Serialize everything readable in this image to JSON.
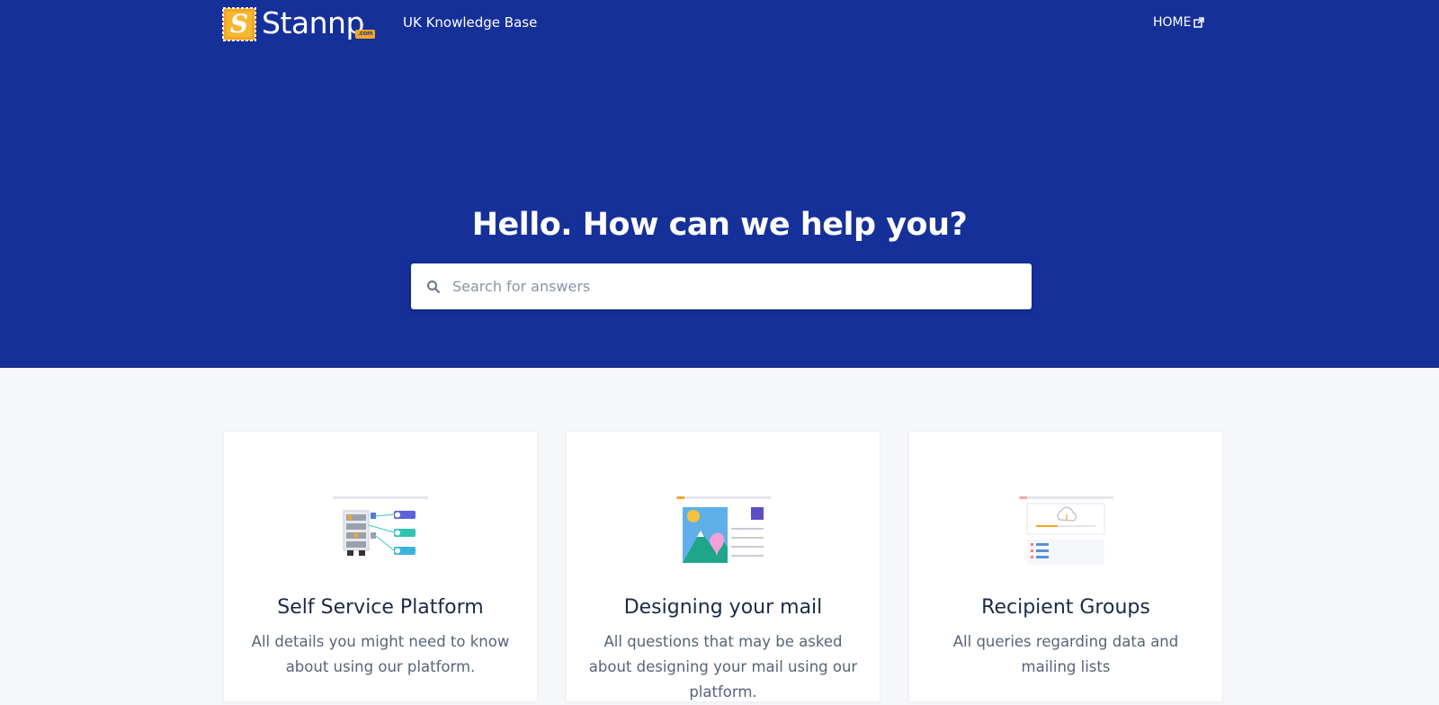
{
  "nav": {
    "logo_text": "Stannp",
    "logo_dotcom": ".com",
    "logo_letter": "S",
    "subtitle": "UK Knowledge Base",
    "home_label": "HOME",
    "home_icon": "external-link-icon"
  },
  "hero": {
    "title": "Hello. How can we help you?",
    "search_placeholder": "Search for answers",
    "search_value": "",
    "search_icon": "search-icon"
  },
  "categories": [
    {
      "title": "Self Service Platform",
      "description": "All details you might need to know about using our platform.",
      "illustration": "platform-illustration"
    },
    {
      "title": "Designing your mail",
      "description": "All questions that may be asked about designing your mail using our platform.",
      "illustration": "design-illustration"
    },
    {
      "title": "Recipient Groups",
      "description": "All queries regarding data and mailing lists",
      "illustration": "recipients-illustration"
    }
  ],
  "colors": {
    "hero_background": "#16309a",
    "logo_stamp": "#f5a623",
    "page_background": "#f5f7fb",
    "card_title": "#1b2b45",
    "card_text": "#56647a"
  }
}
